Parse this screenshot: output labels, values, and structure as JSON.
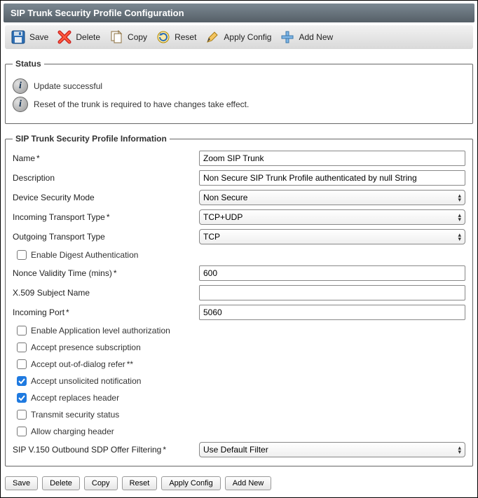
{
  "header": {
    "title": "SIP Trunk Security Profile Configuration"
  },
  "toolbar": {
    "save": "Save",
    "delete": "Delete",
    "copy": "Copy",
    "reset": "Reset",
    "apply_config": "Apply Config",
    "add_new": "Add New"
  },
  "status": {
    "legend": "Status",
    "msg1": "Update successful",
    "msg2": "Reset of the trunk is required to have changes take effect."
  },
  "info": {
    "legend": "SIP Trunk Security Profile Information",
    "labels": {
      "name": "Name",
      "description": "Description",
      "device_security_mode": "Device Security Mode",
      "incoming_transport_type": "Incoming Transport Type",
      "outgoing_transport_type": "Outgoing Transport Type",
      "enable_digest_auth": "Enable Digest Authentication",
      "nonce_validity": "Nonce Validity Time (mins)",
      "x509_subject": "X.509 Subject Name",
      "incoming_port": "Incoming Port",
      "enable_app_level_auth": "Enable Application level authorization",
      "accept_presence_sub": "Accept presence subscription",
      "accept_ood_refer": "Accept out-of-dialog refer",
      "accept_unsolicited_notif": "Accept unsolicited notification",
      "accept_replaces_header": "Accept replaces header",
      "transmit_security_status": "Transmit security status",
      "allow_charging_header": "Allow charging header",
      "sip_v150": "SIP V.150 Outbound SDP Offer Filtering"
    },
    "values": {
      "name": "Zoom SIP Trunk",
      "description": "Non Secure SIP Trunk Profile authenticated by null String",
      "device_security_mode": "Non Secure",
      "incoming_transport_type": "TCP+UDP",
      "outgoing_transport_type": "TCP",
      "enable_digest_auth": false,
      "nonce_validity": "600",
      "x509_subject": "",
      "incoming_port": "5060",
      "enable_app_level_auth": false,
      "accept_presence_sub": false,
      "accept_ood_refer": false,
      "accept_unsolicited_notif": true,
      "accept_replaces_header": true,
      "transmit_security_status": false,
      "allow_charging_header": false,
      "sip_v150": "Use Default Filter"
    }
  },
  "footer": {
    "save": "Save",
    "delete": "Delete",
    "copy": "Copy",
    "reset": "Reset",
    "apply_config": "Apply Config",
    "add_new": "Add New"
  }
}
